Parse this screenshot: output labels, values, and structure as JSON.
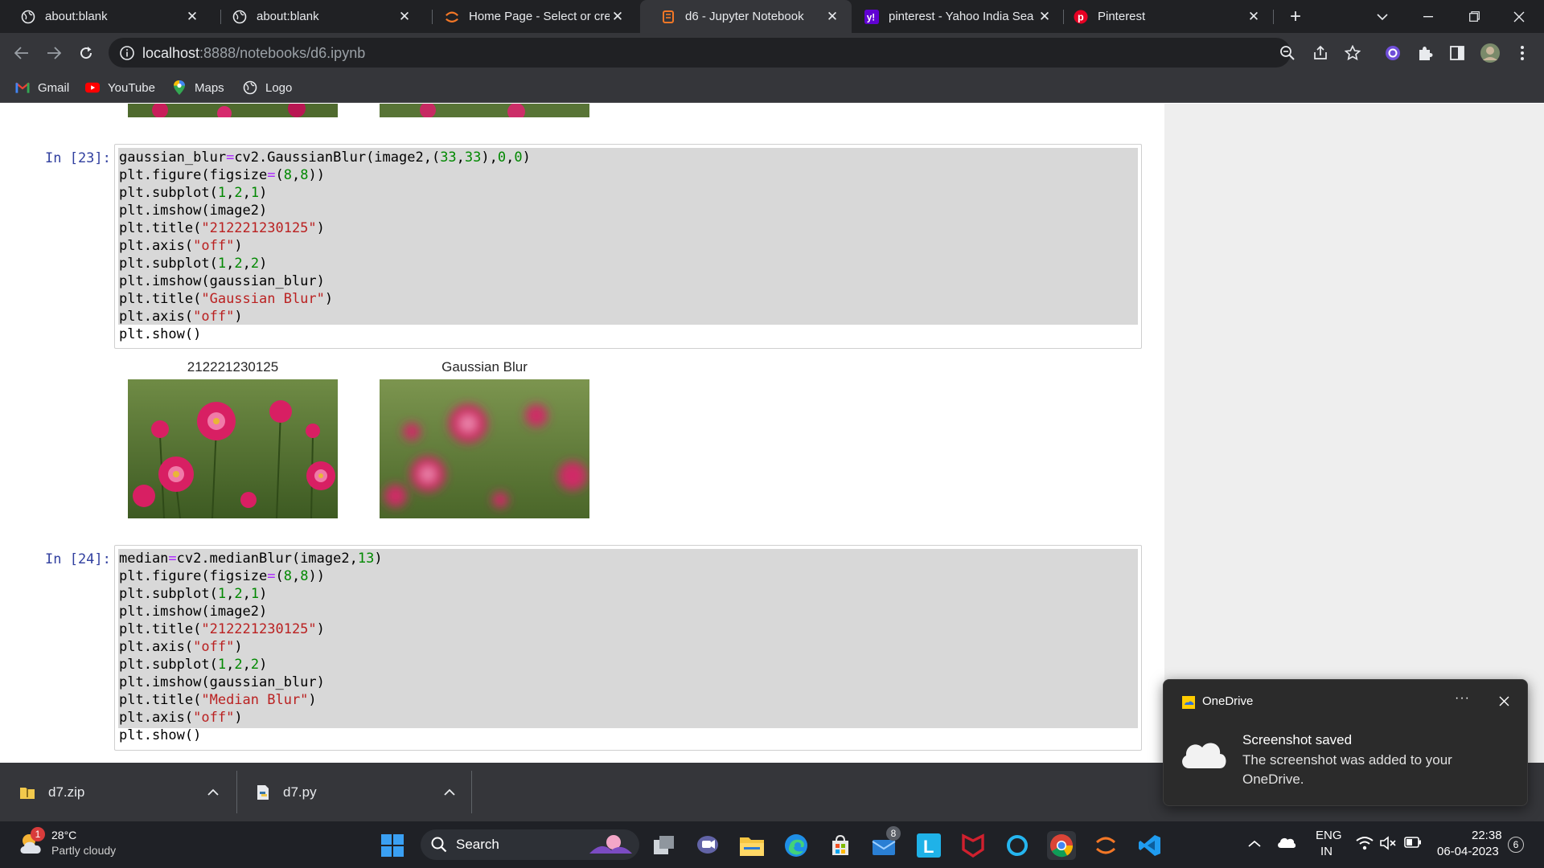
{
  "browser": {
    "tabs": [
      {
        "label": "about:blank",
        "icon": "globe-icon",
        "active": false
      },
      {
        "label": "about:blank",
        "icon": "globe-icon",
        "active": false
      },
      {
        "label": "Home Page - Select or crea",
        "icon": "jupyter-icon",
        "active": false
      },
      {
        "label": "d6 - Jupyter Notebook",
        "icon": "notebook-icon",
        "active": true
      },
      {
        "label": "pinterest - Yahoo India Sea",
        "icon": "yahoo-icon",
        "active": false
      },
      {
        "label": "Pinterest",
        "icon": "pinterest-icon",
        "active": false
      }
    ],
    "url_host": "localhost",
    "url_path": ":8888/notebooks/d6.ipynb",
    "bookmarks": [
      {
        "label": "Gmail",
        "icon": "gmail-icon"
      },
      {
        "label": "YouTube",
        "icon": "youtube-icon"
      },
      {
        "label": "Maps",
        "icon": "maps-icon"
      },
      {
        "label": "Logo",
        "icon": "globe-icon"
      }
    ]
  },
  "notebook": {
    "cells": [
      {
        "prompt": "In [23]:",
        "lines": [
          "gaussian_blur=cv2.GaussianBlur(image2,(33,33),0,0)",
          "plt.figure(figsize=(8,8))",
          "plt.subplot(1,2,1)",
          "plt.imshow(image2)",
          "plt.title(\"212221230125\")",
          "plt.axis(\"off\")",
          "plt.subplot(1,2,2)",
          "plt.imshow(gaussian_blur)",
          "plt.title(\"Gaussian Blur\")",
          "plt.axis(\"off\")",
          "plt.show()"
        ],
        "output_titles": [
          "212221230125",
          "Gaussian Blur"
        ]
      },
      {
        "prompt": "In [24]:",
        "lines": [
          "median=cv2.medianBlur(image2,13)",
          "plt.figure(figsize=(8,8))",
          "plt.subplot(1,2,1)",
          "plt.imshow(image2)",
          "plt.title(\"212221230125\")",
          "plt.axis(\"off\")",
          "plt.subplot(1,2,2)",
          "plt.imshow(gaussian_blur)",
          "plt.title(\"Median Blur\")",
          "plt.axis(\"off\")",
          "plt.show()"
        ]
      }
    ]
  },
  "downloads": [
    {
      "name": "d7.zip",
      "icon": "zip-folder-icon"
    },
    {
      "name": "d7.py",
      "icon": "python-file-icon"
    }
  ],
  "toast": {
    "app": "OneDrive",
    "title": "Screenshot saved",
    "body": "The screenshot was added to your OneDrive."
  },
  "taskbar": {
    "weather_temp": "28°C",
    "weather_desc": "Partly cloudy",
    "weather_badge": "1",
    "search_label": "Search",
    "mail_badge": "8",
    "lang": "ENG",
    "region": "IN",
    "time": "22:38",
    "date": "06-04-2023",
    "notif_count": "6"
  }
}
